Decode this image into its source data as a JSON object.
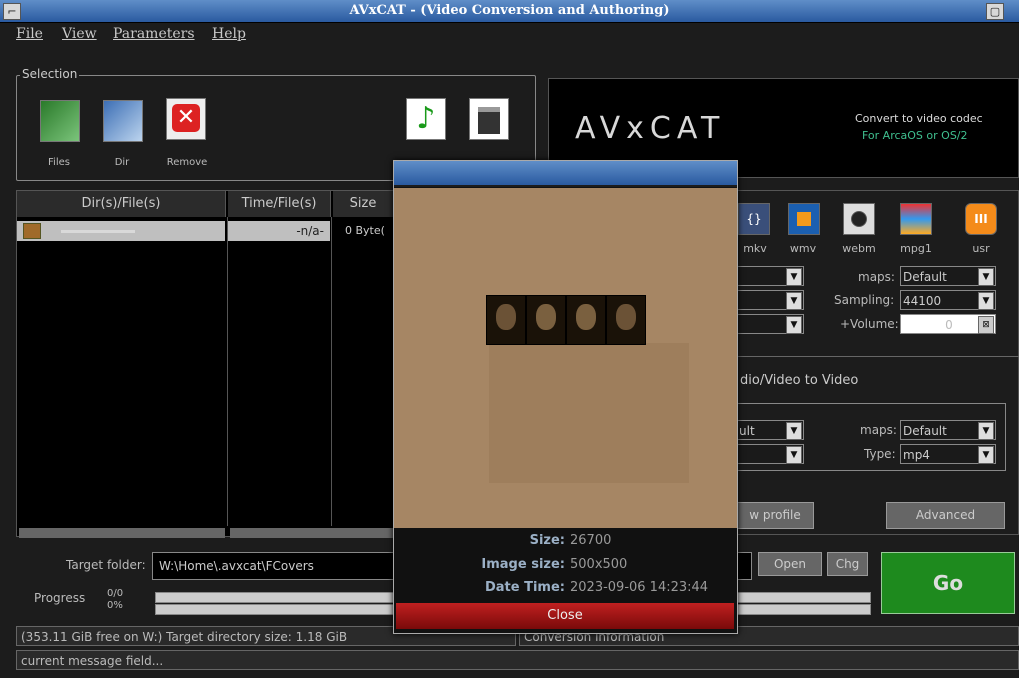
{
  "window": {
    "title": "AVxCAT - (Video Conversion and Authoring)"
  },
  "menu": {
    "file": "File",
    "view": "View",
    "parameters": "Parameters",
    "help": "Help"
  },
  "selection": {
    "label": "Selection",
    "buttons": {
      "files": "Files",
      "dir": "Dir",
      "remove": "Remove"
    }
  },
  "banner": {
    "title": "AVxCAT",
    "line1": "Convert to video codec",
    "line2": "For ArcaOS or OS/2"
  },
  "filelist": {
    "headers": {
      "dirfile": "Dir(s)/File(s)",
      "time": "Time/File(s)",
      "size": "Size"
    },
    "row": {
      "time": "-n/a-",
      "size": "0 Byte("
    }
  },
  "formats": [
    "mkv",
    "wmv",
    "webm",
    "mpg1",
    "usr"
  ],
  "audio": {
    "maps_label": "maps:",
    "maps_value": "Default",
    "sampling_label": "Sampling:",
    "sampling_value": "44100",
    "volume_label": "+Volume:",
    "volume_value": "0"
  },
  "video": {
    "section_label": "dio/Video to Video",
    "left1_value": "ult",
    "maps_label": "maps:",
    "maps_value": "Default",
    "type_label": "Type:",
    "type_value": "mp4"
  },
  "buttons": {
    "new_profile": "w profile",
    "advanced": "Advanced",
    "open": "Open",
    "chg": "Chg",
    "go": "Go"
  },
  "target": {
    "label": "Target folder:",
    "value": "W:\\Home\\.avxcat\\FCovers"
  },
  "progress": {
    "label": "Progress",
    "count": "0/0",
    "percent": "0%"
  },
  "status": {
    "disk": "(353.11 GiB free on W:) Target directory size: 1.18 GiB",
    "conversion": "Conversion information",
    "message": "current message field..."
  },
  "dialog": {
    "size_label": "Size:",
    "size_value": "26700",
    "image_size_label": "Image size:",
    "image_size_value": "500x500",
    "datetime_label": "Date Time:",
    "datetime_value": "2023-09-06 14:23:44",
    "close": "Close"
  },
  "colors": {
    "titlebar": "#2a5aa0",
    "go": "#1e8a1e",
    "close": "#a01010"
  }
}
